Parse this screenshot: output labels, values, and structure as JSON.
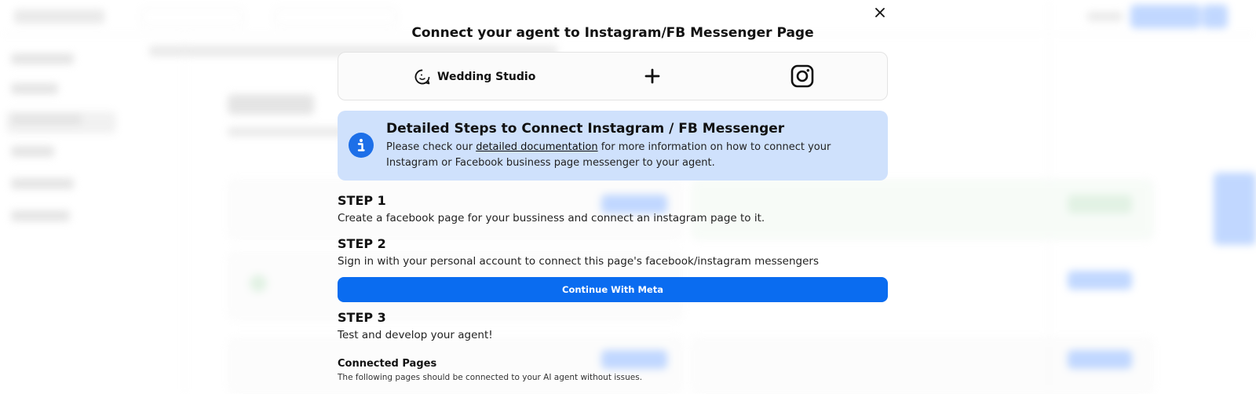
{
  "modal": {
    "title": "Connect your agent to Instagram/FB Messenger Page",
    "agent_name": "Wedding Studio",
    "info": {
      "heading": "Detailed Steps to Connect Instagram / FB Messenger",
      "text_before_link": "Please check our ",
      "link_text": "detailed documentation",
      "text_after_link": " for more information on how to connect your Instagram or Facebook business page messenger to your agent."
    },
    "steps": [
      {
        "title": "STEP 1",
        "text": "Create a facebook page for your bussiness and connect an instagram page to it."
      },
      {
        "title": "STEP 2",
        "text": "Sign in with your personal account to connect this page's facebook/instagram messengers"
      },
      {
        "title": "STEP 3",
        "text": "Test and develop your agent!"
      }
    ],
    "continue_button": "Continue With Meta",
    "connected_pages": {
      "title": "Connected Pages",
      "subtitle": "The following pages should be connected to your AI agent without issues."
    }
  },
  "icons": {
    "close": "close-icon",
    "agent": "chat-agent-icon",
    "plus": "plus-icon",
    "instagram": "instagram-icon",
    "info": "info-icon"
  },
  "colors": {
    "primary_button": "#0a6cf0",
    "info_background": "#cfe1fc",
    "info_icon": "#1d6fe8"
  }
}
